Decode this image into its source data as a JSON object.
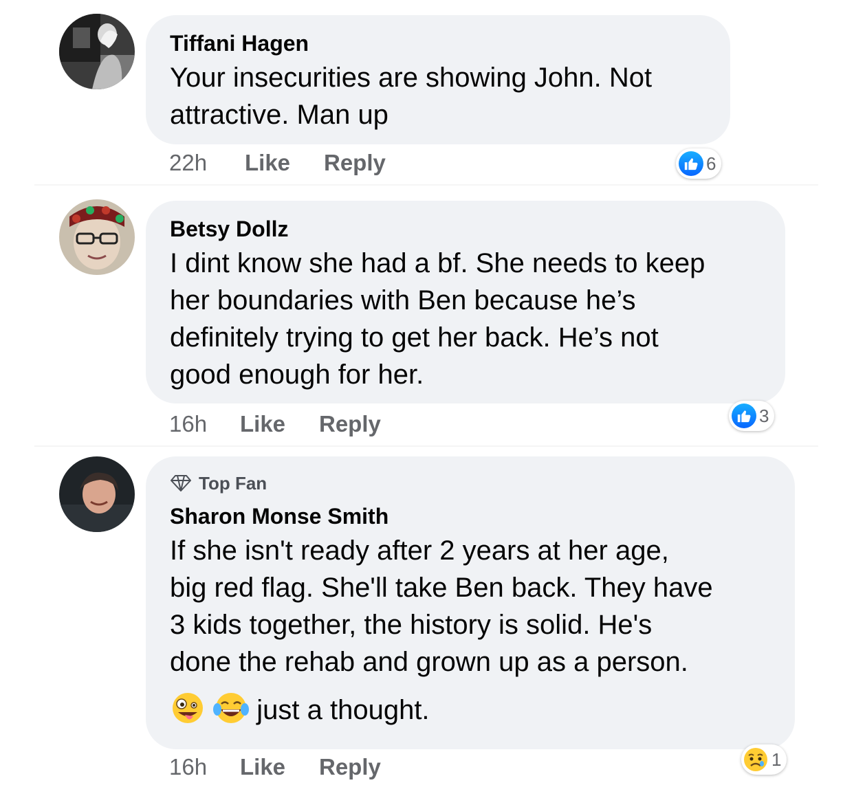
{
  "comments": [
    {
      "author": "Tiffani Hagen",
      "lines": [
        "Your insecurities are showing John. Not",
        "attractive. Man up"
      ],
      "time": "22h",
      "like_label": "Like",
      "reply_label": "Reply",
      "reaction_icon": "like-icon",
      "reaction_count": "6"
    },
    {
      "author": "Betsy Dollz",
      "lines": [
        "I dint know she had a bf. She needs to keep",
        "her boundaries with Ben because he’s",
        "definitely trying to get her back. He’s not",
        "good enough for her."
      ],
      "time": "16h",
      "like_label": "Like",
      "reply_label": "Reply",
      "reaction_icon": "like-icon",
      "reaction_count": "3"
    },
    {
      "badge": "Top Fan",
      "badge_icon": "diamond-icon",
      "author": "Sharon Monse Smith",
      "lines": [
        "If she isn't ready after 2 years at her age,",
        "big red flag. She'll take Ben back. They have",
        "3 kids together, the history is solid. He's",
        "done the rehab and grown up as a person."
      ],
      "last_line_emojis": [
        "zany-face-emoji",
        "tears-of-joy-emoji"
      ],
      "last_line_text": "just a thought.",
      "time": "16h",
      "like_label": "Like",
      "reply_label": "Reply",
      "reaction_icon": "sad-icon",
      "reaction_count": "1"
    }
  ],
  "colors": {
    "bubble": "#f0f2f5",
    "name": "#050505",
    "meta": "#65676b",
    "like_blue": "#0866ff"
  }
}
